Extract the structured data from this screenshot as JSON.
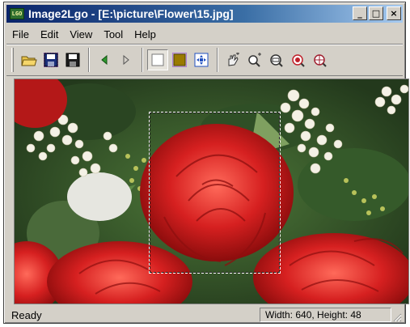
{
  "window": {
    "title": "Image2Lgo - [E:\\picture\\Flower\\15.jpg]",
    "app_icon_text": "LGO",
    "minimize_glyph": "_",
    "maximize_glyph": "□",
    "close_glyph": "×"
  },
  "menu": [
    "File",
    "Edit",
    "View",
    "Tool",
    "Help"
  ],
  "toolbar": {
    "buttons": [
      {
        "icon": "open-folder-icon"
      },
      {
        "icon": "save-as-icon"
      },
      {
        "icon": "save-icon"
      },
      {
        "icon": "previous-icon"
      },
      {
        "icon": "next-icon"
      },
      {
        "icon": "select-rectangle-icon",
        "pressed": true
      },
      {
        "icon": "fill-rectangle-icon"
      },
      {
        "icon": "fit-to-window-icon"
      },
      {
        "icon": "pan-hand-icon"
      },
      {
        "icon": "zoom-in-icon"
      },
      {
        "icon": "zoom-out-icon"
      },
      {
        "icon": "zoom-actual-icon"
      },
      {
        "icon": "zoom-target-icon"
      }
    ]
  },
  "status": {
    "left": "Ready",
    "dimensions": "Width: 640, Height: 48"
  },
  "colors": {
    "titlebar_start": "#0a246a",
    "titlebar_end": "#a6caf0",
    "window_face": "#d4d0c8",
    "rose_red": "#d62020",
    "foliage_green": "#3c5a32"
  }
}
